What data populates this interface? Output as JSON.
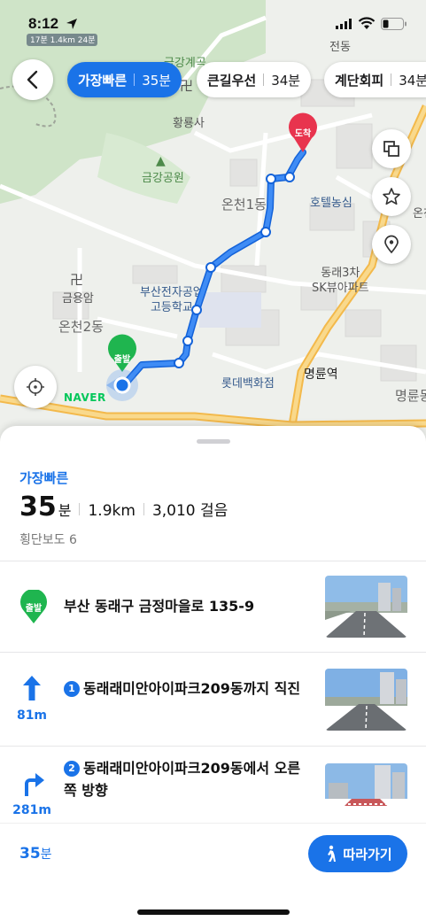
{
  "status": {
    "time": "8:12"
  },
  "map": {
    "labels": {
      "traffic": "17분 1.4km 24분",
      "geumgang_gyegok": "금강계곡",
      "hwangryongsa": "황룡사",
      "geumgang_park": "금강공원",
      "oncheon_dong": "온천1동",
      "hotel_nongsim": "호텔농심",
      "oncheon_right": "온천",
      "geumyongam": "금용암",
      "oncheon2dong": "온천2동",
      "busan_school": "부산전자공업\n고등학교",
      "dongrae_sk": "동래3차\nSK뷰아파트",
      "lotte": "롯데백화점",
      "myeongryun": "명륜역",
      "myeongryun_right": "명륜동",
      "jeon": "전동",
      "naver": "NAVER"
    },
    "dest_label": "도착",
    "start_label": "출발"
  },
  "tabs": [
    {
      "name": "가장빠른",
      "time": "35분",
      "active": true
    },
    {
      "name": "큰길우선",
      "time": "34분",
      "active": false
    },
    {
      "name": "계단회피",
      "time": "34분",
      "active": false
    }
  ],
  "summary": {
    "type": "가장빠른",
    "duration": "35",
    "duration_unit": "분",
    "distance": "1.9km",
    "steps": "3,010 걸음",
    "crosswalks": "횡단보도 6"
  },
  "steps": [
    {
      "badge": "출발",
      "text": "부산 동래구 금정마을로 135-9"
    },
    {
      "num": "1",
      "dist": "81m",
      "text": "동래래미안아이파크209동까지 직진"
    },
    {
      "num": "2",
      "dist": "281m",
      "text": "동래래미안아이파크209동에서 오른쪽 방향"
    }
  ],
  "bottom": {
    "duration": "35",
    "unit": "분",
    "follow_label": "따라가기"
  }
}
